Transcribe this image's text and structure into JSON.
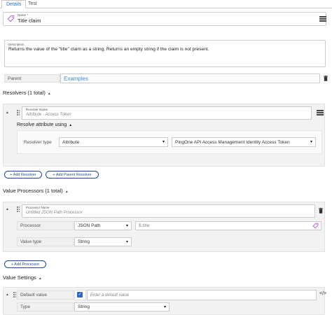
{
  "tabs": [
    {
      "label": "Details",
      "active": true
    },
    {
      "label": "Test",
      "active": false
    }
  ],
  "name": {
    "label": "Name",
    "required_mark": "*",
    "value": "Title claim"
  },
  "description": {
    "label": "Description",
    "value": "Returns the value of the \"title\" claim as a string. Returns an empty string if the claim is not present."
  },
  "parent": {
    "label": "Parent",
    "value": "Examples"
  },
  "resolvers": {
    "title": "Resolvers (1 total)",
    "items": [
      {
        "name_label": "Resolver Name",
        "name_placeholder": "Attribute - Access Token",
        "resolve_title": "Resolve attribute using",
        "type_label": "Resolver type",
        "type_value": "Attribute",
        "source_value": "PingOne API Access Management Identity Access Token"
      }
    ],
    "add_resolver": "+ Add Resolver",
    "add_parent_resolver": "+ Add Parent Resolver"
  },
  "value_processors": {
    "title": "Value Processors (1 total)",
    "items": [
      {
        "name_label": "Processor Name",
        "name_placeholder": "Untitled JSON Path Processor",
        "processor_label": "Processor",
        "processor_value": "JSON Path",
        "expression_value": "$.title",
        "value_type_label": "Value type",
        "value_type_value": "String"
      }
    ],
    "add_processor": "+ Add Processor"
  },
  "value_settings": {
    "title": "Value Settings",
    "default_label": "Default value",
    "default_checked": true,
    "default_placeholder": "Enter a default value",
    "type_label": "Type",
    "type_value": "String"
  },
  "icons": {
    "tag": "tag-icon",
    "menu": "hamburger-menu-icon",
    "trash": "trash-icon",
    "code": "code-icon",
    "caret_up": "caret-up-icon",
    "chevron_down": "chevron-down-icon"
  },
  "colors": {
    "accent": "#1a73c8",
    "link": "#3b8ed6",
    "tag": "#b66fd6",
    "button_border": "#1f4a8c",
    "checkbox": "#2a67c9"
  }
}
